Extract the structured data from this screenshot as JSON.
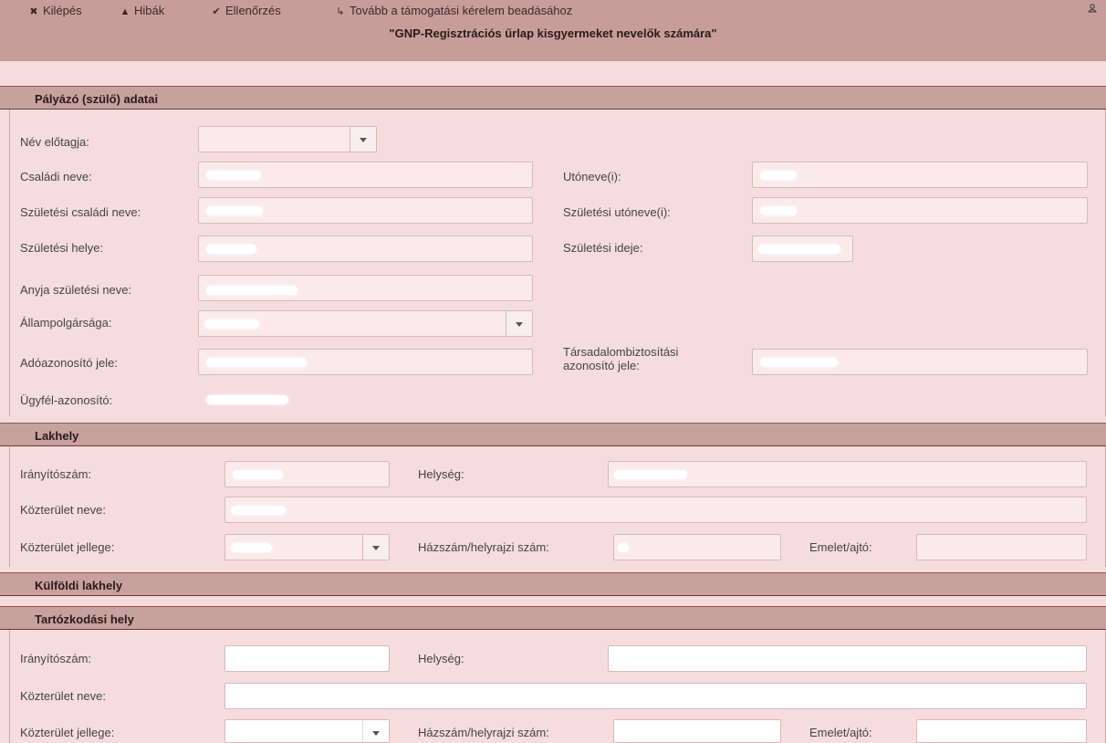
{
  "toolbar": {
    "exit": "Kilépés",
    "errors": "Hibák",
    "check": "Ellenőrzés",
    "next": "Tovább a támogatási kérelem beadásához"
  },
  "page_title": "\"GNP-Regisztrációs űrlap kisgyermeket nevelők számára\"",
  "sections": {
    "applicant": "Pályázó (szülő) adatai",
    "residence": "Lakhely",
    "foreign_residence": "Külföldi lakhely",
    "stay": "Tartózkodási hely"
  },
  "applicant": {
    "name_prefix": "Név előtagja:",
    "family_name": "Családi neve:",
    "given_names": "Utóneve(i):",
    "birth_family_name": "Születési családi neve:",
    "birth_given_names": "Születési utóneve(i):",
    "birth_place": "Születési helye:",
    "birth_date": "Születési ideje:",
    "mother_name": "Anyja születési neve:",
    "citizenship": "Állampolgársága:",
    "tax_id": "Adóazonosító jele:",
    "ssn_line1": "Társadalombiztosítási",
    "ssn_line2": "azonosító jele:",
    "client_id": "Ügyfél-azonosító:"
  },
  "address": {
    "zip": "Irányítószám:",
    "city": "Helység:",
    "street_name": "Közterület neve:",
    "street_type": "Közterület jellege:",
    "house_number": "Házszám/helyrajzi szám:",
    "floor_door": "Emelet/ajtó:"
  }
}
